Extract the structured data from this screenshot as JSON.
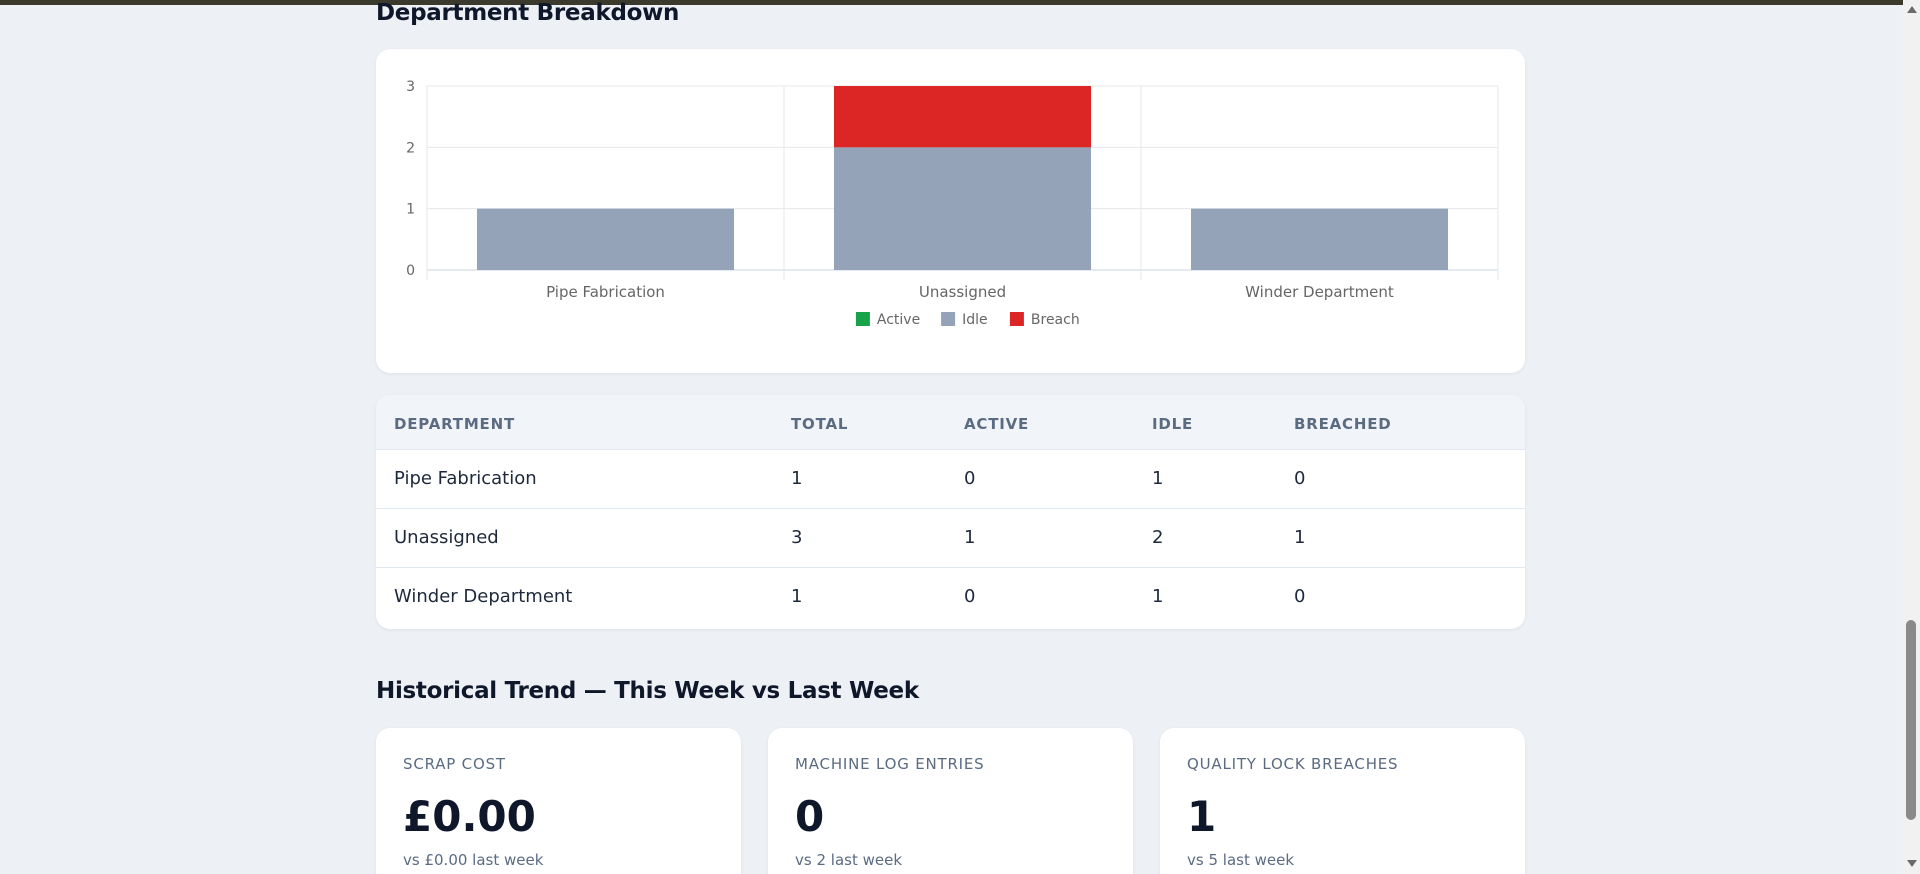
{
  "department_section": {
    "title": "Department Breakdown"
  },
  "chart_data": {
    "type": "bar",
    "stacked": true,
    "categories": [
      "Pipe Fabrication",
      "Unassigned",
      "Winder Department"
    ],
    "series": [
      {
        "name": "Active",
        "color": "#16a34a",
        "values": [
          0,
          0,
          0
        ]
      },
      {
        "name": "Idle",
        "color": "#94a3b8",
        "values": [
          1,
          2,
          1
        ]
      },
      {
        "name": "Breach",
        "color": "#dc2626",
        "values": [
          0,
          1,
          0
        ]
      }
    ],
    "yticks": [
      "0",
      "1",
      "2",
      "3"
    ],
    "ylim": [
      0,
      3
    ],
    "grid": true,
    "legend_position": "bottom"
  },
  "table": {
    "headers": [
      "DEPARTMENT",
      "TOTAL",
      "ACTIVE",
      "IDLE",
      "BREACHED"
    ],
    "rows": [
      [
        "Pipe Fabrication",
        "1",
        "0",
        "1",
        "0"
      ],
      [
        "Unassigned",
        "3",
        "1",
        "2",
        "1"
      ],
      [
        "Winder Department",
        "1",
        "0",
        "1",
        "0"
      ]
    ]
  },
  "trend_section": {
    "title": "Historical Trend — This Week vs Last Week"
  },
  "kpis": [
    {
      "label": "SCRAP COST",
      "value": "£0.00",
      "sub": "vs £0.00 last week"
    },
    {
      "label": "MACHINE LOG ENTRIES",
      "value": "0",
      "sub": "vs 2 last week"
    },
    {
      "label": "QUALITY LOCK BREACHES",
      "value": "1",
      "sub": "vs 5 last week"
    }
  ]
}
